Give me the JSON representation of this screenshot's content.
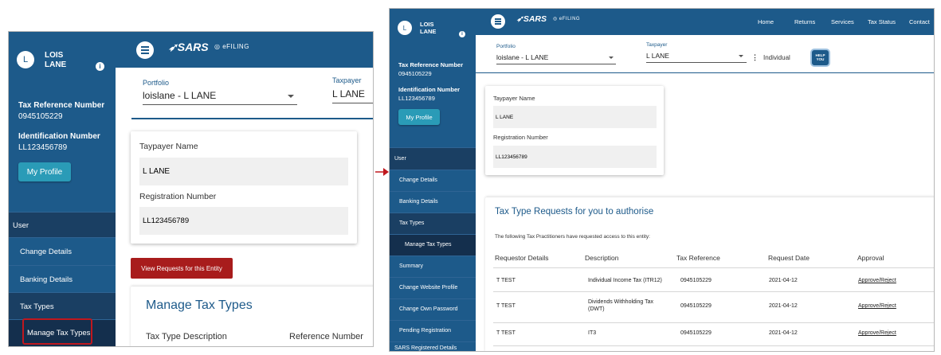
{
  "user": {
    "initial": "L",
    "name_line1": "LOIS",
    "name_line2": "LANE",
    "info_glyph": "i"
  },
  "sidebar": {
    "tax_ref_label": "Tax Reference Number",
    "tax_ref_value": "0945105229",
    "id_label": "Identification Number",
    "id_value": "LL123456789",
    "profile_button": "My Profile",
    "menu_panel1": [
      "User",
      "Change Details",
      "Banking Details",
      "Tax Types",
      "Manage Tax Types"
    ],
    "menu_panel2": [
      "User",
      "Change Details",
      "Banking Details",
      "Tax Types",
      "Manage Tax Types",
      "Summary",
      "Change Website Profile",
      "Change Own Password",
      "Pending Registration",
      "SARS Registered Details"
    ]
  },
  "header": {
    "logo": "SARS",
    "efiling": "eFILING",
    "nav": [
      "Home",
      "Returns",
      "Services",
      "Tax Status",
      "Contact"
    ]
  },
  "filters": {
    "portfolio_label": "Portfolio",
    "portfolio_value": "loislane - L LANE",
    "taxpayer_label": "Taxpayer",
    "taxpayer_value": "L LANE",
    "type_value": "Individual",
    "help_badge": "HELP YOU"
  },
  "entity": {
    "name_label": "Taypayer Name",
    "name_value": "L LANE",
    "reg_label": "Registration Number",
    "reg_value": "LL123456789"
  },
  "panel1": {
    "view_requests_button": "View Requests for this Entity",
    "section_title": "Manage Tax Types",
    "col_desc": "Tax Type Description",
    "col_ref": "Reference Number"
  },
  "requests": {
    "title": "Tax Type Requests for you to authorise",
    "subtitle": "The following Tax Practitioners have requested access to this entity:",
    "columns": [
      "Requestor Details",
      "Description",
      "Tax Reference",
      "Request Date",
      "Approval"
    ],
    "rows": [
      {
        "requestor": "T TEST",
        "description": "Individual Income Tax (ITR12)",
        "tax_ref": "0945105229",
        "date": "2021-04-12",
        "approval": "Approve/Reject"
      },
      {
        "requestor": "T TEST",
        "description": "Dividends Withholding Tax (DWT)",
        "tax_ref": "0945105229",
        "date": "2021-04-12",
        "approval": "Approve/Reject"
      },
      {
        "requestor": "T TEST",
        "description": "IT3",
        "tax_ref": "0945105229",
        "date": "2021-04-12",
        "approval": "Approve/Reject"
      }
    ]
  },
  "colors": {
    "brand_blue": "#1d5a8a",
    "menu_dark": "#1a3f63",
    "accent_red": "#a81c1c",
    "profile_teal": "#2a9bb7"
  }
}
